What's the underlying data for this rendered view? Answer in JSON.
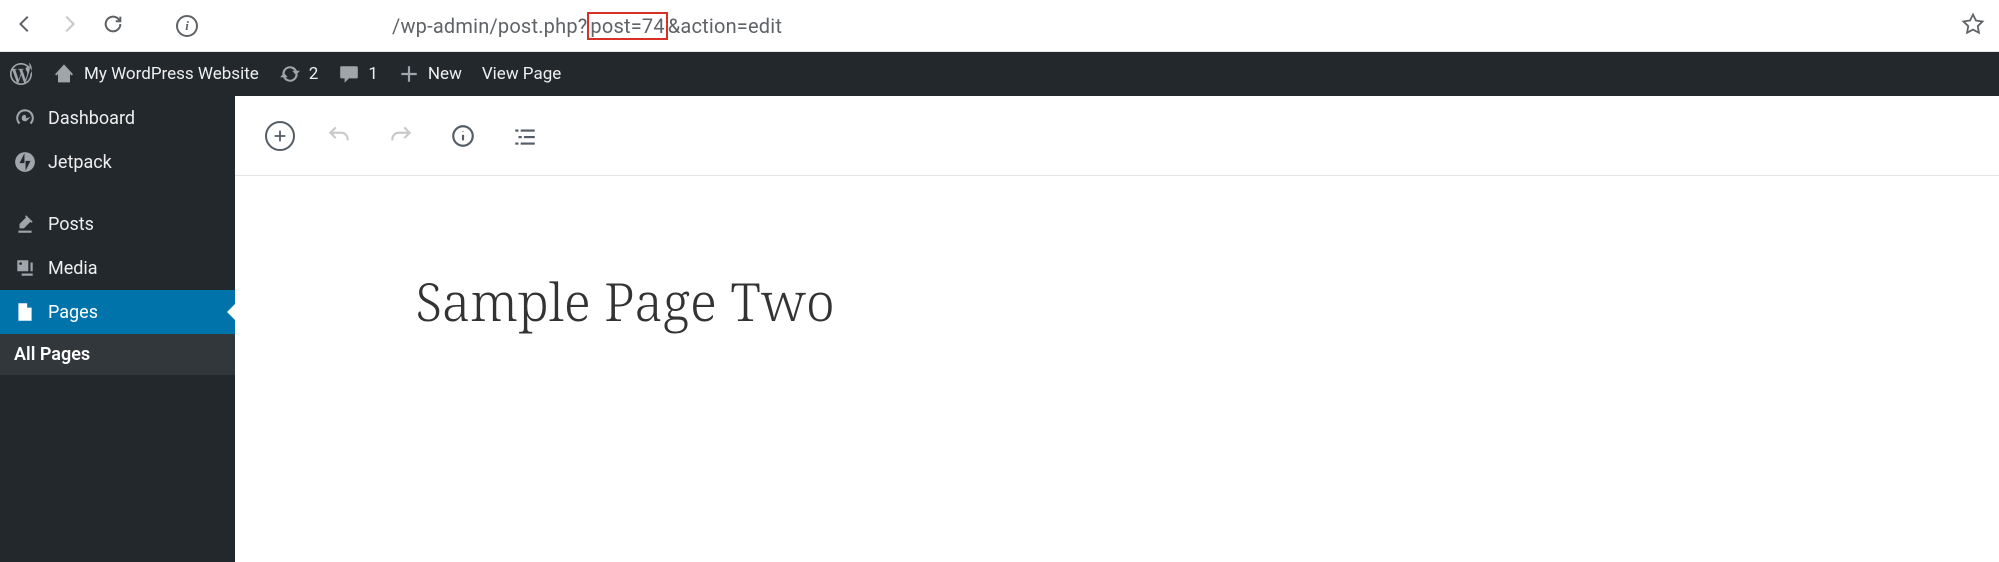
{
  "browser": {
    "url_prefix": "/wp-admin/post.php?",
    "url_highlight": "post=74",
    "url_suffix": "&action=edit"
  },
  "adminbar": {
    "site_title": "My WordPress Website",
    "updates_count": "2",
    "comments_count": "1",
    "new_label": "New",
    "view_label": "View Page"
  },
  "sidebar": {
    "items": [
      {
        "label": "Dashboard"
      },
      {
        "label": "Jetpack"
      },
      {
        "label": "Posts"
      },
      {
        "label": "Media"
      },
      {
        "label": "Pages"
      }
    ],
    "submenu_label": "All Pages"
  },
  "editor": {
    "post_title": "Sample Page Two"
  }
}
